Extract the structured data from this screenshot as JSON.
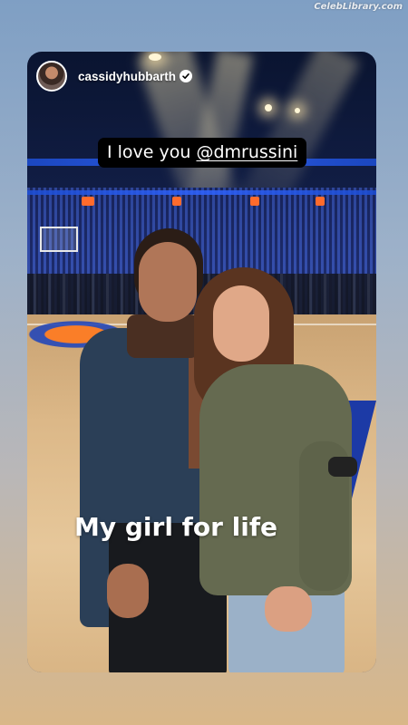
{
  "watermark": {
    "text": "CelebLibrary.com"
  },
  "story": {
    "username": "cassidyhubbarth",
    "verified": true,
    "avatar_icon": "profile-avatar",
    "caption_top": {
      "text": "I love you ",
      "mention": "@dmrussini"
    },
    "caption_bottom": "My girl for life"
  },
  "colors": {
    "arena_blue": "#243a8a",
    "court_wood": "#dcb888",
    "caption_bg": "#000000",
    "text": "#ffffff"
  }
}
